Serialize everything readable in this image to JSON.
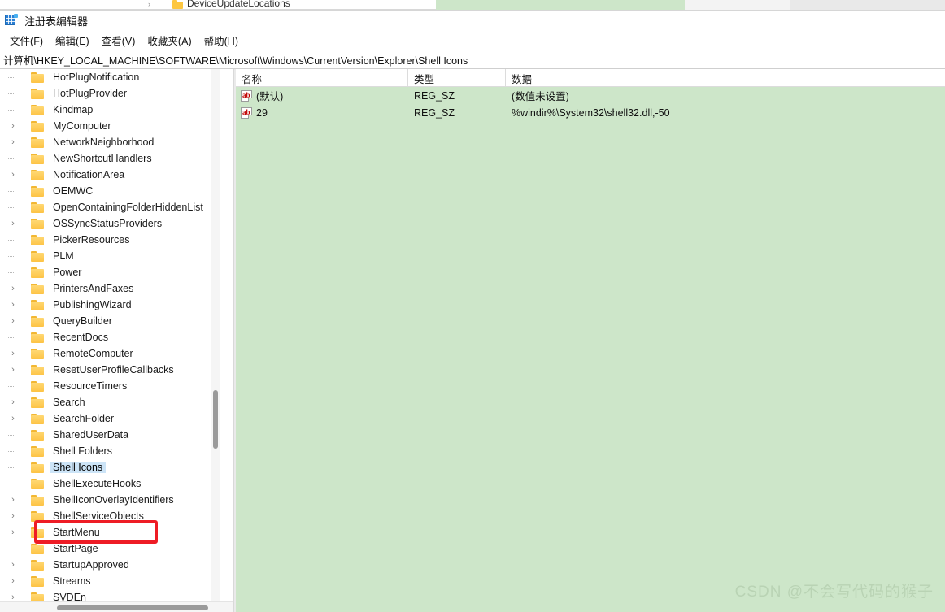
{
  "background_window": {
    "tree_item_label": "DeviceUpdateLocations",
    "watermark": "CSDN @不会写代码的猴子"
  },
  "window": {
    "title": "注册表编辑器",
    "icon": "registry-editor-icon"
  },
  "menubar": {
    "items": [
      {
        "label": "文件(F)",
        "text": "文件",
        "accel": "F"
      },
      {
        "label": "编辑(E)",
        "text": "编辑",
        "accel": "E"
      },
      {
        "label": "查看(V)",
        "text": "查看",
        "accel": "V"
      },
      {
        "label": "收藏夹(A)",
        "text": "收藏夹",
        "accel": "A"
      },
      {
        "label": "帮助(H)",
        "text": "帮助",
        "accel": "H"
      }
    ]
  },
  "address_bar": {
    "path": "计算机\\HKEY_LOCAL_MACHINE\\SOFTWARE\\Microsoft\\Windows\\CurrentVersion\\Explorer\\Shell Icons"
  },
  "tree": {
    "items": [
      {
        "label": "HotPlugNotification",
        "expandable": false,
        "selected": false
      },
      {
        "label": "HotPlugProvider",
        "expandable": false,
        "selected": false
      },
      {
        "label": "Kindmap",
        "expandable": false,
        "selected": false
      },
      {
        "label": "MyComputer",
        "expandable": true,
        "selected": false
      },
      {
        "label": "NetworkNeighborhood",
        "expandable": true,
        "selected": false
      },
      {
        "label": "NewShortcutHandlers",
        "expandable": false,
        "selected": false
      },
      {
        "label": "NotificationArea",
        "expandable": true,
        "selected": false
      },
      {
        "label": "OEMWC",
        "expandable": false,
        "selected": false
      },
      {
        "label": "OpenContainingFolderHiddenList",
        "expandable": false,
        "selected": false
      },
      {
        "label": "OSSyncStatusProviders",
        "expandable": true,
        "selected": false
      },
      {
        "label": "PickerResources",
        "expandable": false,
        "selected": false
      },
      {
        "label": "PLM",
        "expandable": false,
        "selected": false
      },
      {
        "label": "Power",
        "expandable": false,
        "selected": false
      },
      {
        "label": "PrintersAndFaxes",
        "expandable": true,
        "selected": false
      },
      {
        "label": "PublishingWizard",
        "expandable": true,
        "selected": false
      },
      {
        "label": "QueryBuilder",
        "expandable": true,
        "selected": false
      },
      {
        "label": "RecentDocs",
        "expandable": false,
        "selected": false
      },
      {
        "label": "RemoteComputer",
        "expandable": true,
        "selected": false
      },
      {
        "label": "ResetUserProfileCallbacks",
        "expandable": true,
        "selected": false
      },
      {
        "label": "ResourceTimers",
        "expandable": false,
        "selected": false
      },
      {
        "label": "Search",
        "expandable": true,
        "selected": false
      },
      {
        "label": "SearchFolder",
        "expandable": true,
        "selected": false
      },
      {
        "label": "SharedUserData",
        "expandable": false,
        "selected": false
      },
      {
        "label": "Shell Folders",
        "expandable": false,
        "selected": false
      },
      {
        "label": "Shell Icons",
        "expandable": false,
        "selected": true
      },
      {
        "label": "ShellExecuteHooks",
        "expandable": false,
        "selected": false
      },
      {
        "label": "ShellIconOverlayIdentifiers",
        "expandable": true,
        "selected": false
      },
      {
        "label": "ShellServiceObjects",
        "expandable": true,
        "selected": false
      },
      {
        "label": "StartMenu",
        "expandable": true,
        "selected": false
      },
      {
        "label": "StartPage",
        "expandable": false,
        "selected": false
      },
      {
        "label": "StartupApproved",
        "expandable": true,
        "selected": false
      },
      {
        "label": "Streams",
        "expandable": true,
        "selected": false
      },
      {
        "label": "SVDEn",
        "expandable": true,
        "selected": false
      }
    ]
  },
  "value_list": {
    "columns": [
      "名称",
      "类型",
      "数据"
    ],
    "rows": [
      {
        "name": "(默认)",
        "type": "REG_SZ",
        "data": "(数值未设置)",
        "icon": "string-value-icon"
      },
      {
        "name": "29",
        "type": "REG_SZ",
        "data": "%windir%\\System32\\shell32.dll,-50",
        "icon": "string-value-icon"
      }
    ]
  },
  "watermark": {
    "text": "CSDN @不会写代码的猴子"
  },
  "colors": {
    "selection": "#cce4f7",
    "annotation": "#ee1c25",
    "pane_background": "#cde6c9",
    "folder": "#fdc345"
  }
}
